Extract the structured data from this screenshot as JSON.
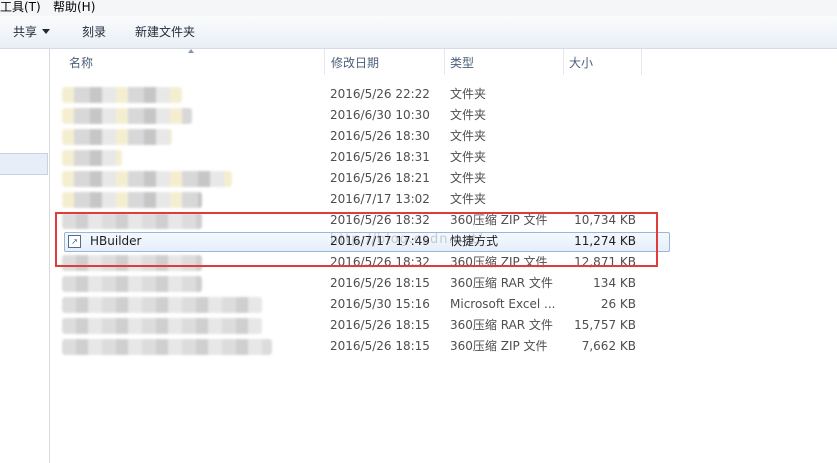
{
  "menu": {
    "tools": "工具(T)",
    "help": "帮助(H)"
  },
  "toolbar": {
    "share": "共享",
    "burn": "刻录",
    "new_folder": "新建文件夹"
  },
  "columns": {
    "name": "名称",
    "date": "修改日期",
    "type": "类型",
    "size": "大小"
  },
  "files": [
    {
      "name": "",
      "date": "2016/5/26 22:22",
      "type": "文件夹",
      "size": ""
    },
    {
      "name": "",
      "date": "2016/6/30 10:30",
      "type": "文件夹",
      "size": ""
    },
    {
      "name": "",
      "date": "2016/5/26 18:30",
      "type": "文件夹",
      "size": ""
    },
    {
      "name": "",
      "date": "2016/5/26 18:31",
      "type": "文件夹",
      "size": ""
    },
    {
      "name": "",
      "date": "2016/5/26 18:21",
      "type": "文件夹",
      "size": ""
    },
    {
      "name": "",
      "date": "2016/7/17 13:02",
      "type": "文件夹",
      "size": ""
    },
    {
      "name": "",
      "date": "2016/5/26 18:32",
      "type": "360压缩 ZIP 文件",
      "size": "10,734 KB"
    },
    {
      "name": "HBuilder",
      "date": "2016/7/17 17:49",
      "type": "快捷方式",
      "size": "11,274 KB"
    },
    {
      "name": "",
      "date": "2016/5/26 18:32",
      "type": "360压缩 ZIP 文件",
      "size": "12,871 KB"
    },
    {
      "name": "",
      "date": "2016/5/26 18:15",
      "type": "360压缩 RAR 文件",
      "size": "134 KB"
    },
    {
      "name": "",
      "date": "2016/5/30 15:16",
      "type": "Microsoft Excel ...",
      "size": "26 KB"
    },
    {
      "name": "",
      "date": "2016/5/26 18:15",
      "type": "360压缩 RAR 文件",
      "size": "15,757 KB"
    },
    {
      "name": "",
      "date": "2016/5/26 18:15",
      "type": "360压缩 ZIP 文件",
      "size": "7,662 KB"
    }
  ],
  "watermark": "http://blog.csdn.net/"
}
